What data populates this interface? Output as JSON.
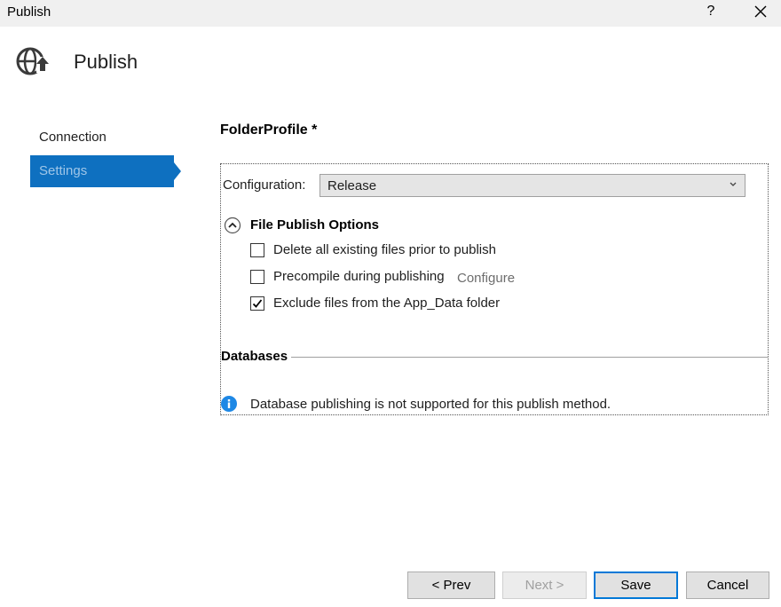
{
  "window": {
    "title": "Publish",
    "help_label": "?"
  },
  "header": {
    "title": "Publish",
    "icon": "globe-publish-icon"
  },
  "nav": {
    "items": [
      {
        "label": "Connection",
        "selected": false
      },
      {
        "label": "Settings",
        "selected": true
      }
    ]
  },
  "profile": {
    "name": "FolderProfile *"
  },
  "settings": {
    "configuration_label": "Configuration:",
    "configuration_value": "Release",
    "file_publish": {
      "title": "File Publish Options",
      "options": [
        {
          "label": "Delete all existing files prior to publish",
          "checked": false
        },
        {
          "label": "Precompile during publishing",
          "checked": false
        },
        {
          "label": "Exclude files from the App_Data folder",
          "checked": true
        }
      ],
      "configure_link": "Configure"
    },
    "databases": {
      "title": "Databases",
      "message": "Database publishing is not supported for this publish method."
    }
  },
  "buttons": {
    "prev": "< Prev",
    "next": "Next >",
    "save": "Save",
    "cancel": "Cancel"
  },
  "colors": {
    "accent": "#0e70c0",
    "info": "#1e88e5",
    "disabled_text": "#a0a0a0"
  }
}
